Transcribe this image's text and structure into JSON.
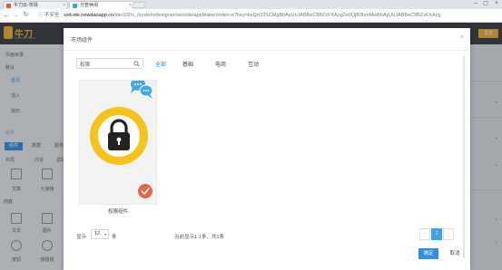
{
  "browser": {
    "tabs": [
      {
        "title": "牛刀云-市场",
        "active": false
      },
      {
        "title": "分管休闲",
        "active": true
      }
    ],
    "security_label": "不安全",
    "url_host": "ssd-ide.newdaoapp.cn",
    "url_path": "/ide/Ul2/v_/system/designer/webIde/appMaker/index.w?key=bxQrO3SCMgBbAyUnJABBeC8BZxFXAzg2e0QjB3hmMwBbAyUnJABBeC8BZxFXAzg"
  },
  "app": {
    "logo_text": "牛刀",
    "logo_sub": "NEWDAO.COM",
    "header_button": "发布",
    "sidebar": {
      "section1": "页面目录",
      "section1_item": "默认",
      "items": [
        "首页",
        "插入",
        "我的"
      ],
      "section2": "组件",
      "tabs": [
        "组件",
        "数据",
        "服务"
      ],
      "layout_group": "布局",
      "layout_sub": [
        "内容",
        "基础"
      ],
      "layout_items": [
        "文章",
        "九宫格"
      ],
      "section3": "内容",
      "content_items": [
        "文本",
        "图片",
        "按钮",
        "按钮组"
      ]
    }
  },
  "modal": {
    "title": "市场组件",
    "search_value": "权限",
    "tabs": [
      "全部",
      "基础",
      "电商",
      "互动"
    ],
    "active_tab": 0,
    "card": {
      "label": "权限组件"
    },
    "pagination": {
      "show_label": "显示",
      "page_size": "12",
      "unit": "条",
      "info": "当前显示1-1条，共1条",
      "pages": [
        "‹",
        "1",
        "›"
      ],
      "current_page": "1"
    },
    "confirm_label": "确定",
    "cancel_label": "取消"
  },
  "colors": {
    "accent": "#1e88e5",
    "brand": "#f5a623",
    "lock_ring": "#f7c21a",
    "badge_red": "#e8634f",
    "chat_blue": "#3fa9e6"
  }
}
